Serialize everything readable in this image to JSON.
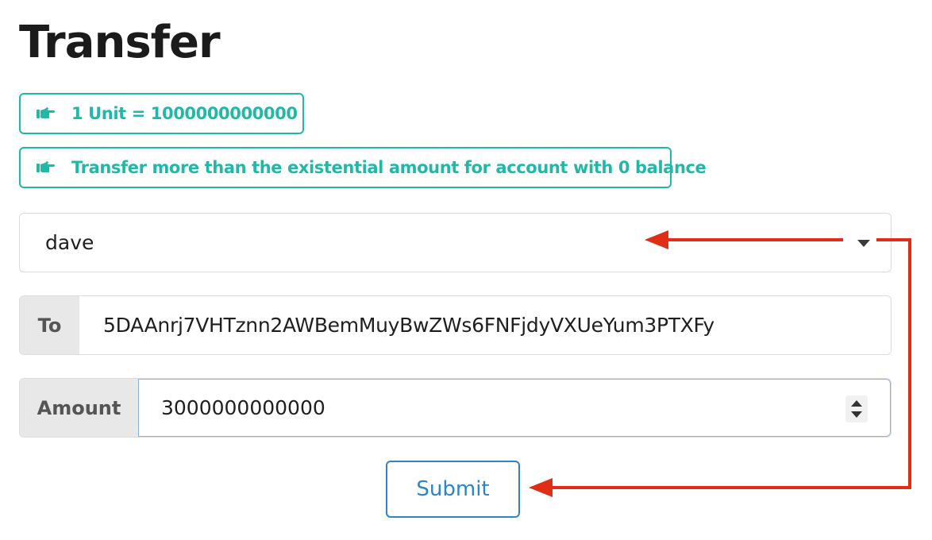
{
  "page": {
    "title": "Transfer"
  },
  "info_messages": [
    {
      "icon": "pointing-hand-icon",
      "text": "1 Unit = 1000000000000"
    },
    {
      "icon": "pointing-hand-icon",
      "text": "Transfer more than the existential amount for account with 0 balance"
    }
  ],
  "form": {
    "from_account": {
      "selected": "dave",
      "icon": "dropdown-caret-icon"
    },
    "to": {
      "label": "To",
      "value": "5DAAnrj7VHTznn2AWBemMuyBwZWs6FNFjdyVXUeYum3PTXFy"
    },
    "amount": {
      "label": "Amount",
      "value": "3000000000000"
    },
    "submit_label": "Submit"
  },
  "annotation": {
    "arrow_color": "#e02d14"
  },
  "colors": {
    "info_teal": "#21b8a8",
    "button_blue": "#2b85c8",
    "label_bg": "#e8e8e8"
  }
}
